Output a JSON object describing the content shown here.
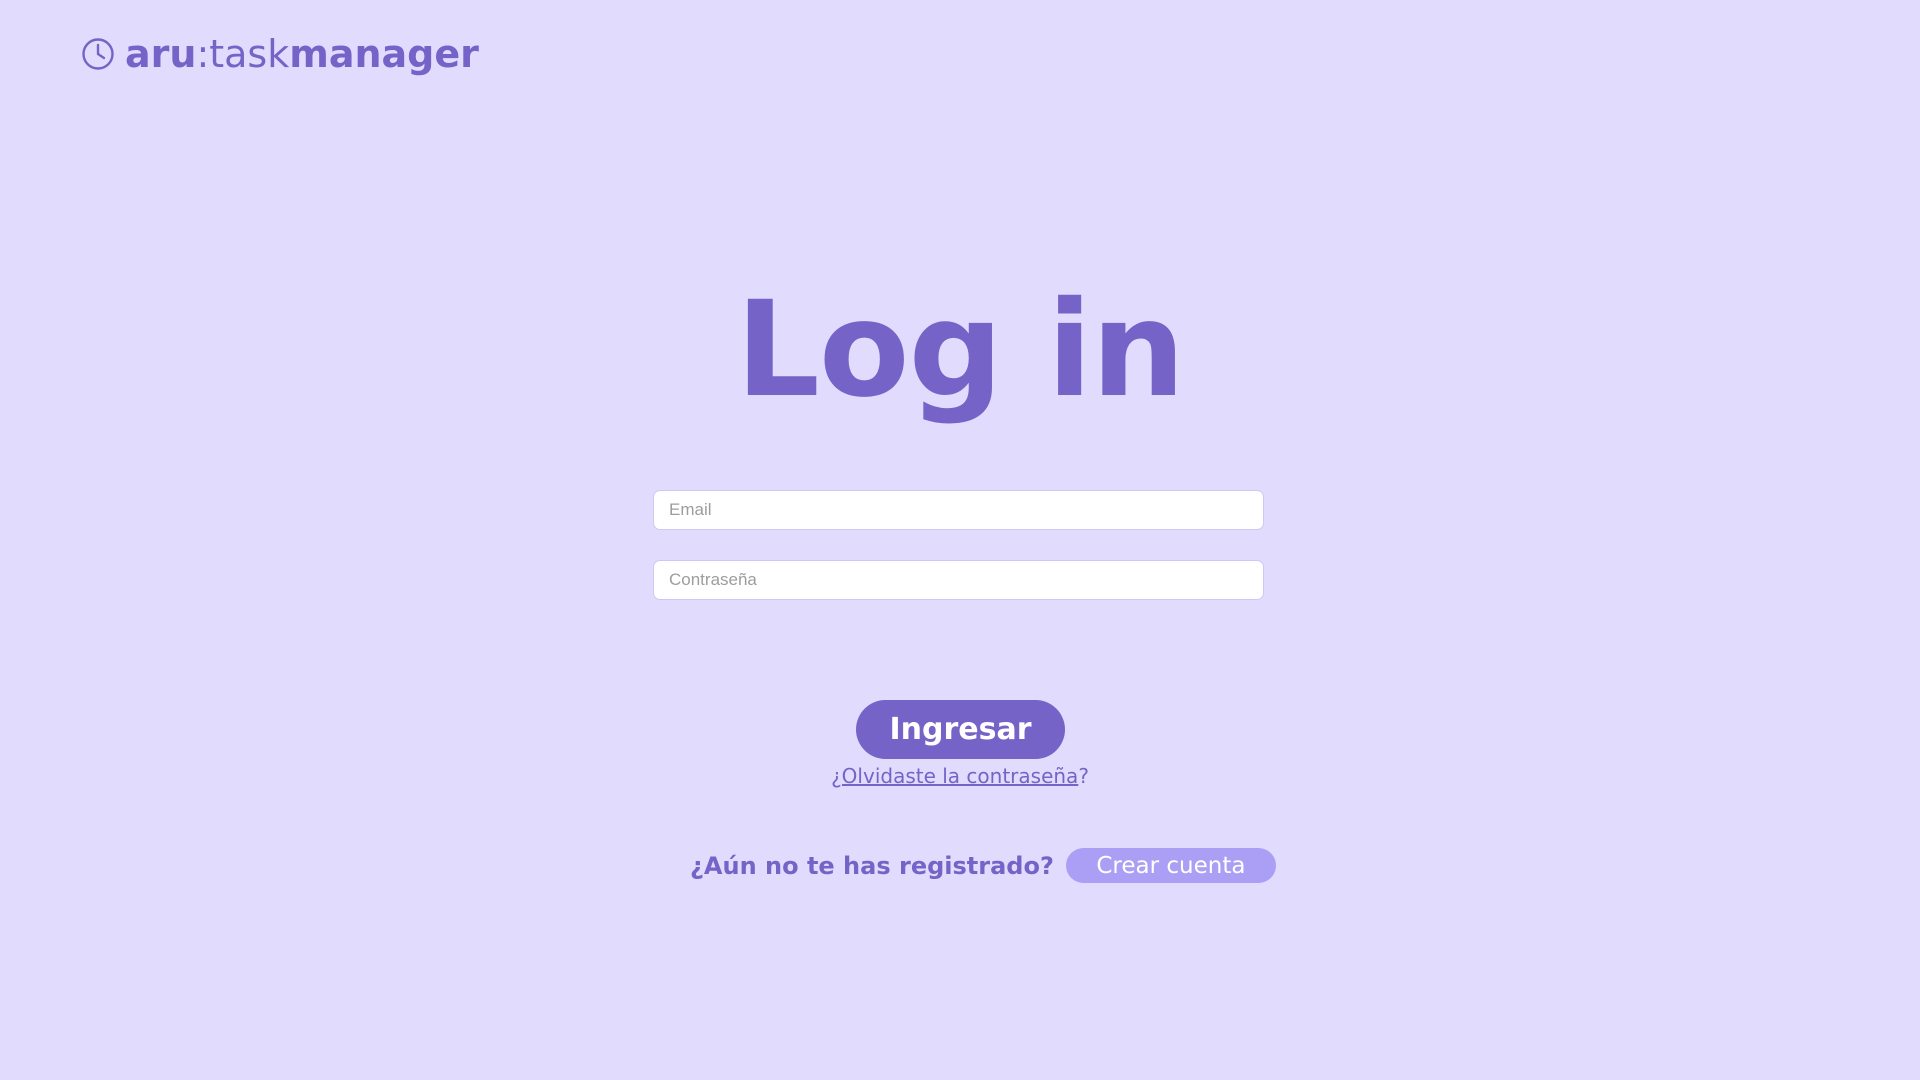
{
  "brand": {
    "icon": "clock-icon",
    "part_bold_1": "aru",
    "part_light": ":task",
    "part_bold_2": "manager"
  },
  "login": {
    "title": "Log in",
    "email_placeholder": "Email",
    "password_placeholder": "Contraseña",
    "submit_label": "Ingresar",
    "forgot_link": "¿Olvidaste la contraseña",
    "forgot_suffix": "?"
  },
  "register": {
    "question": "¿Aún no te has registrado?",
    "button_label": "Crear cuenta"
  },
  "colors": {
    "background": "#e1dcfd",
    "accent": "#7563c7",
    "secondary_button": "#ab9ff5"
  }
}
